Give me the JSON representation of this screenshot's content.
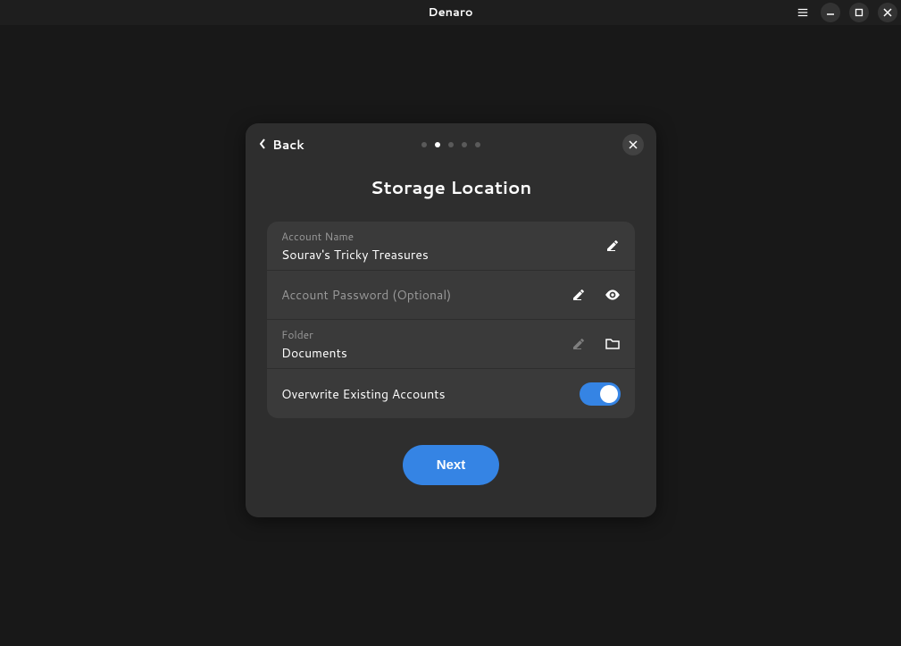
{
  "app": {
    "title": "Denaro"
  },
  "dialog": {
    "back_label": "Back",
    "title": "Storage Location",
    "pages_total": 5,
    "pages_active_index": 1,
    "fields": {
      "account_name": {
        "label": "Account Name",
        "value": "Sourav's Tricky Treasures"
      },
      "password": {
        "placeholder": "Account Password (Optional)",
        "value": ""
      },
      "folder": {
        "label": "Folder",
        "value": "Documents"
      },
      "overwrite": {
        "label": "Overwrite Existing Accounts",
        "enabled": true
      }
    },
    "next_label": "Next"
  },
  "colors": {
    "accent": "#3584e4"
  }
}
